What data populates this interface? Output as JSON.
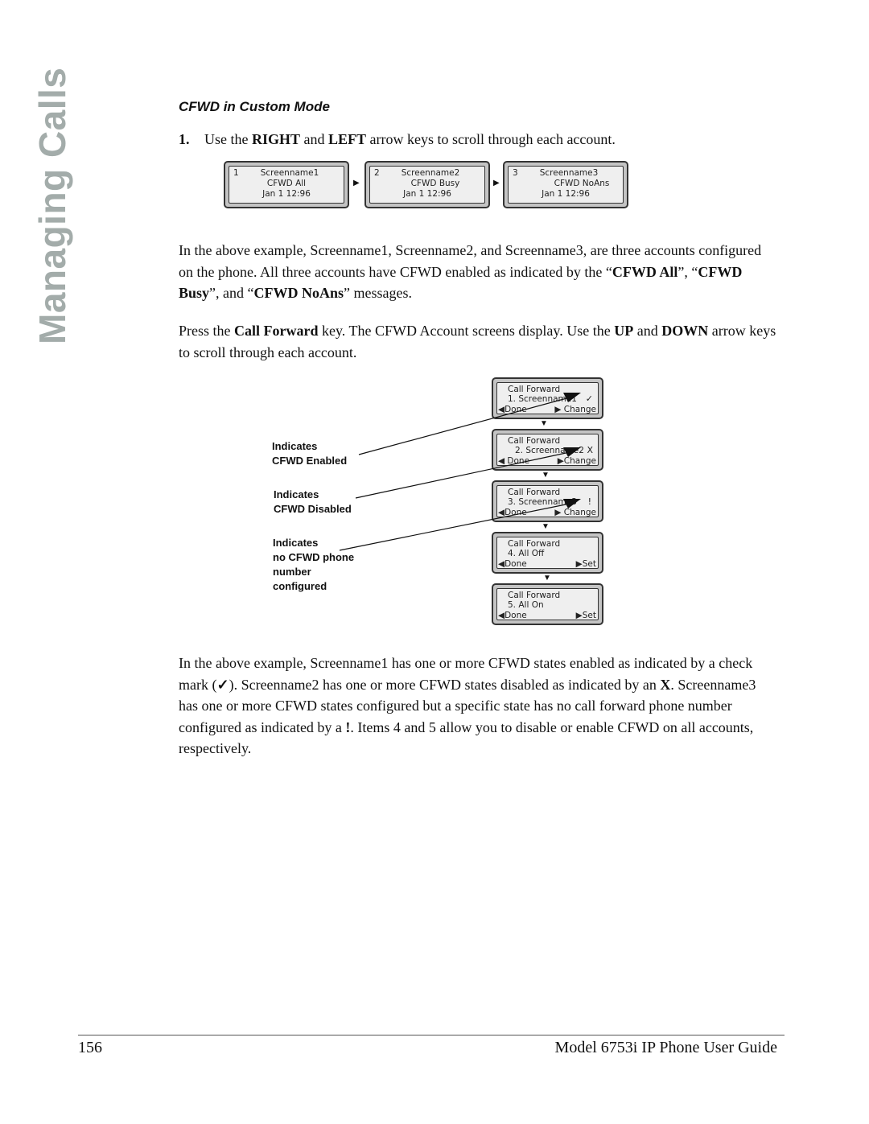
{
  "side_title": "Managing Calls",
  "section_title": "CFWD in Custom Mode",
  "step1": {
    "number": "1.",
    "parts": [
      {
        "t": "Use the ",
        "b": false
      },
      {
        "t": "RIGHT",
        "b": true
      },
      {
        "t": " and ",
        "b": false
      },
      {
        "t": "LEFT",
        "b": true
      },
      {
        "t": " arrow keys to scroll through each account.",
        "b": false
      }
    ]
  },
  "account_screens": [
    {
      "index": "1",
      "name": "Screenname1",
      "status": "CFWD All",
      "datetime": "Jan 1 12:96"
    },
    {
      "index": "2",
      "name": "Screenname2",
      "status": "CFWD Busy",
      "datetime": "Jan 1 12:96"
    },
    {
      "index": "3",
      "name": "Screenname3",
      "status": "CFWD NoAns",
      "datetime": "Jan 1 12:96"
    }
  ],
  "paragraph1": [
    {
      "t": "In the above example, Screenname1, Screenname2, and Screenname3, are three accounts configured on the phone. All three accounts have CFWD enabled as indicated by the “",
      "b": false
    },
    {
      "t": "CFWD All",
      "b": true
    },
    {
      "t": "”, “",
      "b": false
    },
    {
      "t": "CFWD Busy",
      "b": true
    },
    {
      "t": "”, and “",
      "b": false
    },
    {
      "t": "CFWD NoAns",
      "b": true
    },
    {
      "t": "” messages.",
      "b": false
    }
  ],
  "paragraph2": [
    {
      "t": "Press the ",
      "b": false
    },
    {
      "t": "Call Forward",
      "b": true
    },
    {
      "t": " key. The CFWD Account screens display. Use the ",
      "b": false
    },
    {
      "t": "UP",
      "b": true
    },
    {
      "t": " and ",
      "b": false
    },
    {
      "t": "DOWN",
      "b": true
    },
    {
      "t": " arrow keys to scroll through each account.",
      "b": false
    }
  ],
  "cfwd_screens": [
    {
      "title": "Call Forward",
      "item": "1. Screenname1",
      "mark": "✓",
      "left_key": "Done",
      "right_key": "Change"
    },
    {
      "title": "Call Forward",
      "item": "2. Screenname2",
      "mark": "X",
      "left_key": "Done",
      "right_key": "Change"
    },
    {
      "title": "Call Forward",
      "item": "3. Screenname3",
      "mark": "!",
      "left_key": "Done",
      "right_key": "Change"
    },
    {
      "title": "Call Forward",
      "item": "4. All Off",
      "mark": "",
      "left_key": "Done",
      "right_key": "Set"
    },
    {
      "title": "Call Forward",
      "item": "5. All On",
      "mark": "",
      "left_key": "Done",
      "right_key": "Set"
    }
  ],
  "callout_labels": [
    {
      "lines": [
        "Indicates",
        "CFWD Enabled"
      ]
    },
    {
      "lines": [
        "Indicates",
        "CFWD Disabled"
      ]
    },
    {
      "lines": [
        "Indicates",
        "no CFWD phone",
        "number",
        "configured"
      ]
    }
  ],
  "paragraph3": [
    {
      "t": "In the above example, Screenname1 has one or more CFWD states enabled as indicated by a check mark (",
      "b": false
    },
    {
      "t": "✓",
      "b": true
    },
    {
      "t": "). Screenname2 has one or more CFWD states disabled as indicated by an ",
      "b": false
    },
    {
      "t": "X",
      "b": true
    },
    {
      "t": ". Screenname3 has one or more CFWD states configured but a specific state has no call forward phone number configured as indicated by a ",
      "b": false
    },
    {
      "t": "!",
      "b": true
    },
    {
      "t": ". Items 4 and 5 allow you to disable or enable CFWD on all accounts, respectively.",
      "b": false
    }
  ],
  "footer": {
    "page_number": "156",
    "guide_title": "Model 6753i IP Phone User Guide"
  },
  "glyphs": {
    "right_triangle": "▶",
    "left_triangle": "◀",
    "down_triangle": "▼"
  }
}
